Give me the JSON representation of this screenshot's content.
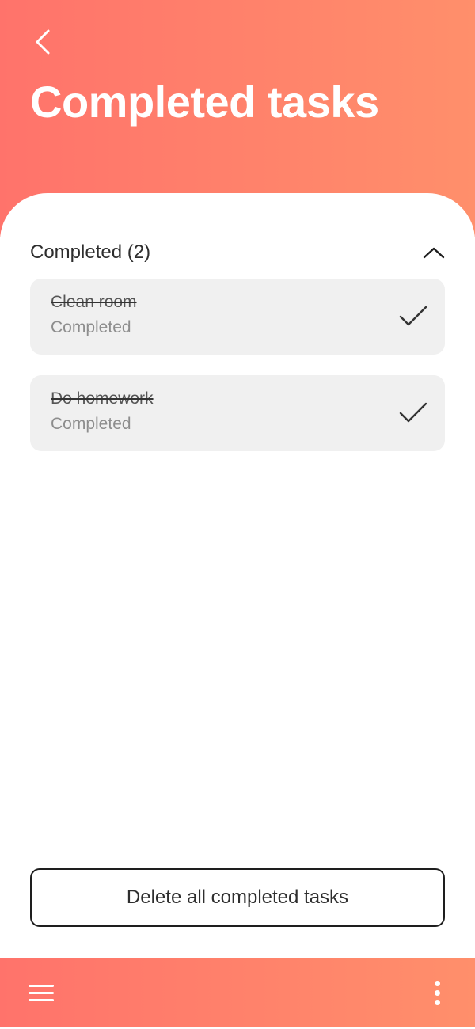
{
  "header": {
    "back_icon": "chevron-left-icon",
    "title": "Completed tasks",
    "gradient": [
      "#ff736b",
      "#ff8f6b"
    ]
  },
  "section": {
    "title": "Completed (2)",
    "collapse_icon": "chevron-up-icon"
  },
  "tasks": [
    {
      "name": "Clean room",
      "status": "Completed",
      "icon": "checkmark-icon"
    },
    {
      "name": "Do homework",
      "status": "Completed",
      "icon": "checkmark-icon"
    }
  ],
  "actions": {
    "delete_label": "Delete all completed tasks"
  },
  "bottom_bar": {
    "menu_icon": "hamburger-menu-icon",
    "more_icon": "more-vertical-icon"
  }
}
